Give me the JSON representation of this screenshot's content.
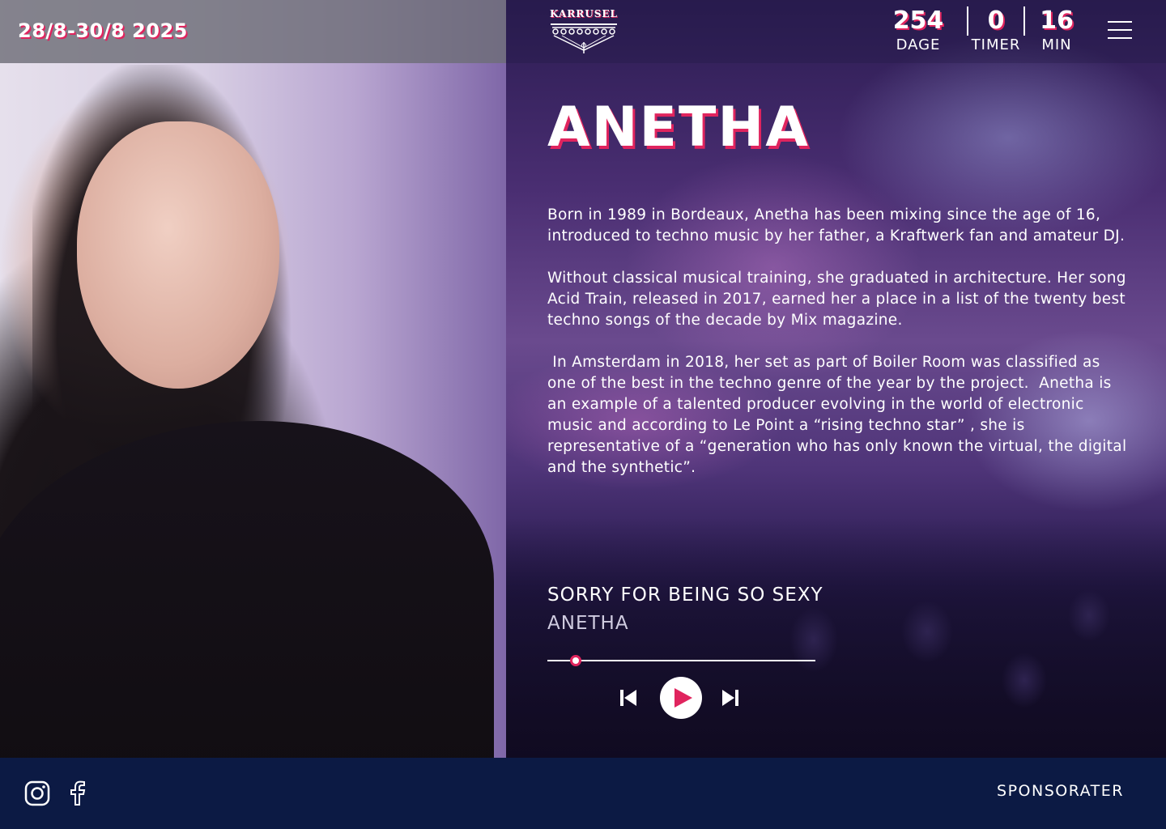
{
  "header": {
    "date_range": "28/8-30/8 2025",
    "logo_text": "KARRUSEL",
    "countdown": [
      {
        "value": "254",
        "label": "DAGE"
      },
      {
        "value": "0",
        "label": "TIMER"
      },
      {
        "value": "16",
        "label": "MIN"
      }
    ],
    "menu_icon": "hamburger-icon"
  },
  "artist": {
    "name": "ANETHA",
    "bio": [
      "Born in 1989 in Bordeaux, Anetha has been mixing since the age of 16, introduced to techno music by her father, a Kraftwerk fan and amateur DJ.",
      "Without classical musical training, she graduated in architecture.  Her song Acid Train, released in 2017, earned her a place in a list of the twenty best techno songs of the decade by Mix magazine.",
      " In Amsterdam in 2018, her set as part of Boiler Room was classified as one of the best in the techno genre of the year by the project.  Anetha is an example of a talented producer evolving in the world of electronic music and according to Le Point a “rising techno star” , she is representative of a “generation who has only known the virtual, the digital and the synthetic”."
    ]
  },
  "player": {
    "track_title": "SORRY FOR BEING SO SEXY",
    "track_artist": "ANETHA",
    "progress": 0.105,
    "icons": {
      "previous": "skip-previous-icon",
      "play": "play-icon",
      "next": "skip-next-icon"
    }
  },
  "footer": {
    "social_icons": [
      "instagram-icon",
      "facebook-icon"
    ],
    "sponsor_label": "SPONSORATER"
  },
  "colors": {
    "accent": "#e0245e",
    "footer_bg": "#0c1a44"
  }
}
